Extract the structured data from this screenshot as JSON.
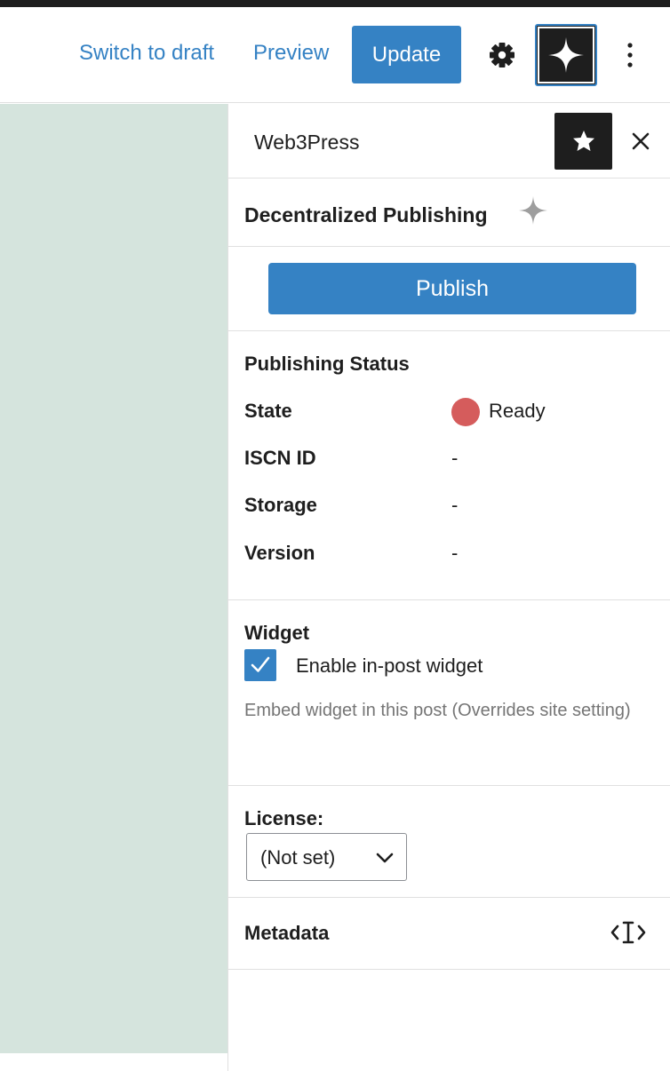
{
  "toolbar": {
    "switch_to_draft_label": "Switch to draft",
    "preview_label": "Preview",
    "update_label": "Update",
    "settings_icon": "gear-icon",
    "plugin_icon": "sparkle-icon",
    "more_icon": "more-vertical-icon"
  },
  "sidebar": {
    "title": "Web3Press",
    "pin_icon": "star-icon",
    "close_icon": "close-icon"
  },
  "plugin": {
    "name": "Decentralized Publishing",
    "icon": "sparkle-icon"
  },
  "publish": {
    "button_label": "Publish"
  },
  "status": {
    "heading": "Publishing Status",
    "rows": [
      {
        "label": "State",
        "value": "Ready"
      },
      {
        "label": "ISCN ID",
        "value": "-"
      },
      {
        "label": "Storage",
        "value": "-"
      },
      {
        "label": "Version",
        "value": "-"
      }
    ],
    "state_color": "#d55c5c"
  },
  "widget": {
    "heading": "Widget",
    "checkbox_label": "Enable in-post widget",
    "checked": true,
    "help_text": "Embed widget in this post (Overrides site setting)"
  },
  "license": {
    "label": "License:",
    "selected": "(Not set)"
  },
  "metadata": {
    "label": "Metadata",
    "icon": "code-cursor-icon"
  },
  "colors": {
    "accent": "#3582c4",
    "dark": "#1e1e1e",
    "canvas": "#d5e4dd",
    "border": "#e0e0e0"
  }
}
